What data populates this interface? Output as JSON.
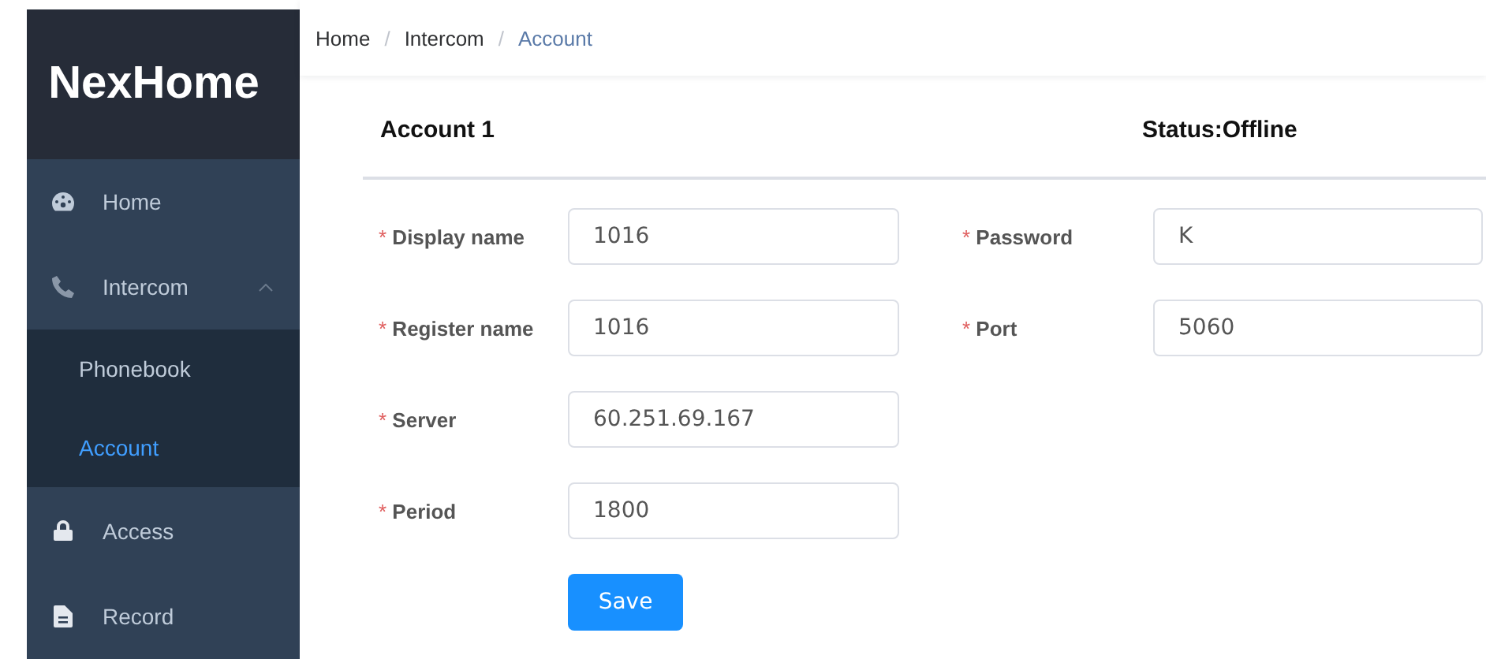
{
  "sidebar": {
    "logo": "NexHome",
    "items": [
      {
        "label": "Home",
        "selected": false
      },
      {
        "label": "Intercom",
        "expanded": true,
        "selected": false,
        "children": [
          {
            "label": "Phonebook",
            "selected": false
          },
          {
            "label": "Account",
            "selected": true
          }
        ]
      },
      {
        "label": "Access",
        "selected": false
      },
      {
        "label": "Record",
        "selected": false
      }
    ]
  },
  "breadcrumb": [
    {
      "label": "Home",
      "selected": false
    },
    {
      "label": "Intercom",
      "selected": false
    },
    {
      "label": "Account",
      "selected": true
    }
  ],
  "breadcrumb_separator": "/",
  "panel": {
    "title": "Account 1",
    "status": "Status:Offline"
  },
  "form": {
    "columns": [
      [
        {
          "label": "Display name",
          "required": true,
          "value": "1016"
        },
        {
          "label": "Register name",
          "required": true,
          "value": "1016"
        },
        {
          "label": "Server",
          "required": true,
          "value": "60.251.69.167"
        },
        {
          "label": "Period",
          "required": true,
          "value": "1800"
        }
      ],
      [
        {
          "label": "Password",
          "required": true,
          "value": "K"
        },
        {
          "label": "Port",
          "required": true,
          "value": "5060"
        }
      ]
    ],
    "required_mark": "*",
    "save_button": "Save"
  }
}
